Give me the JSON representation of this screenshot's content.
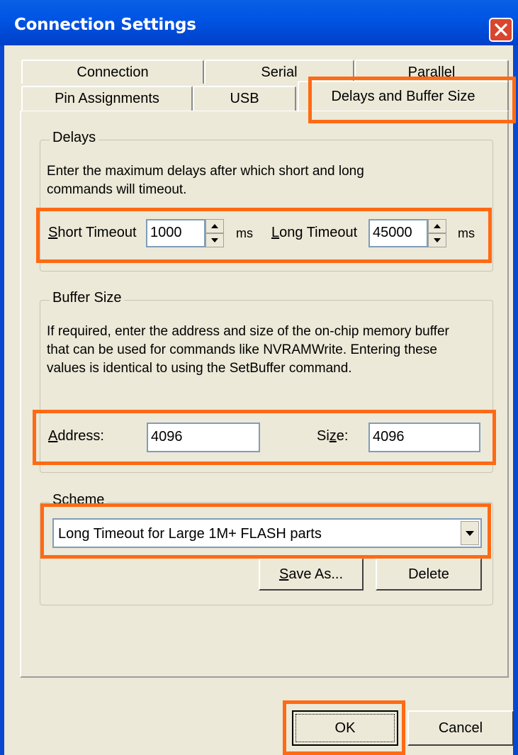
{
  "window": {
    "title": "Connection Settings"
  },
  "tabs": {
    "row_back": [
      "Connection",
      "Serial",
      "Parallel"
    ],
    "row_front": [
      "Pin Assignments",
      "USB"
    ],
    "active": "Delays and Buffer Size"
  },
  "delays": {
    "legend": "Delays",
    "description": "Enter the maximum delays after which short and long commands will timeout.",
    "short_label_first": "S",
    "short_label_rest": "hort Timeout",
    "short_value": "1000",
    "short_unit": "ms",
    "long_label_first": "L",
    "long_label_rest": "ong Timeout",
    "long_value": "45000",
    "long_unit": "ms"
  },
  "buffer": {
    "legend": "Buffer Size",
    "description": "If required, enter the address and size of the on-chip memory buffer that can be used for commands like NVRAMWrite. Entering these values is identical to using the SetBuffer command.",
    "address_label_first": "A",
    "address_label_rest": "ddress:",
    "address_value": "4096",
    "size_label_pre": "Si",
    "size_label_u": "z",
    "size_label_post": "e:",
    "size_value": "4096"
  },
  "scheme": {
    "legend": "Scheme",
    "selected": "Long Timeout for Large 1M+ FLASH parts",
    "save_as_first": "S",
    "save_as_rest": "ave As...",
    "delete": "Delete"
  },
  "footer": {
    "ok": "OK",
    "cancel": "Cancel"
  },
  "colors": {
    "highlight": "#ff6a14",
    "titlebar": "#0055e5",
    "dialog": "#ece9d8"
  }
}
